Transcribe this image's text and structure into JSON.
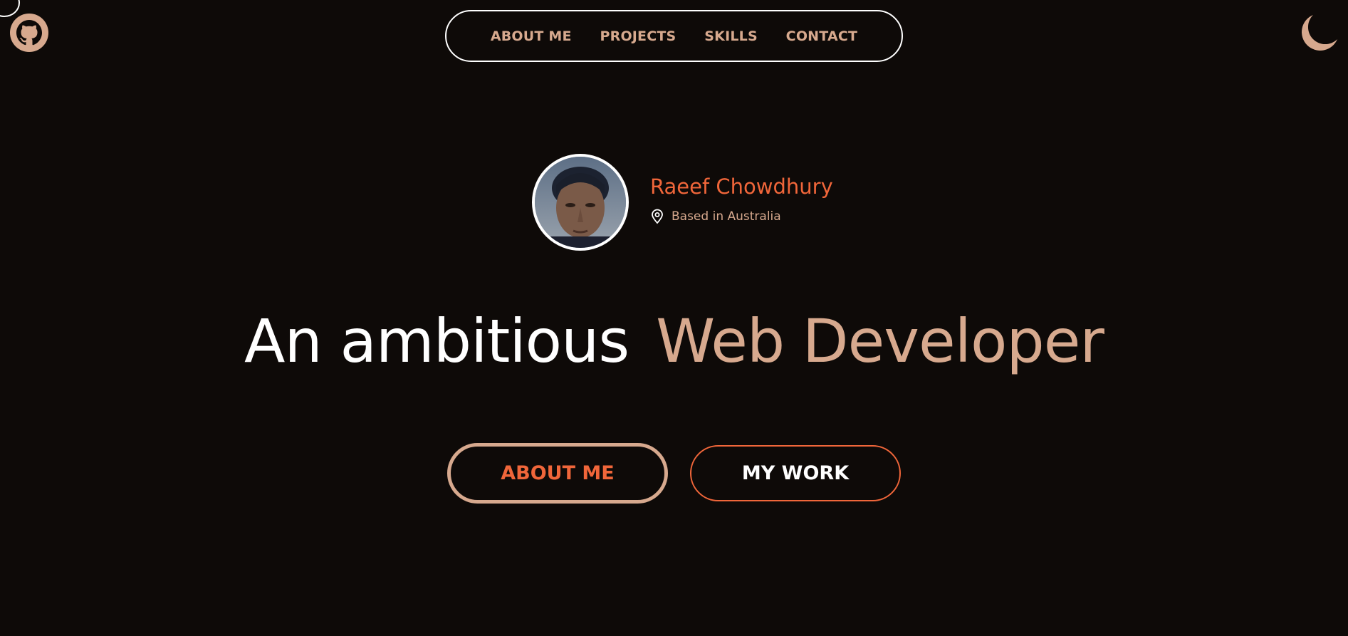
{
  "colors": {
    "background": "#0e0a08",
    "accent_orange": "#f0663a",
    "accent_tan": "#d7a98e",
    "white": "#ffffff"
  },
  "icons": {
    "github": "github-icon",
    "theme": "moon-icon",
    "location": "location-pin-icon"
  },
  "nav": {
    "items": [
      {
        "label": "ABOUT ME"
      },
      {
        "label": "PROJECTS"
      },
      {
        "label": "SKILLS"
      },
      {
        "label": "CONTACT"
      }
    ]
  },
  "profile": {
    "name": "Raeef Chowdhury",
    "location": "Based in Australia"
  },
  "hero": {
    "headline_plain": "An ambitious",
    "headline_accent": "Web Developer"
  },
  "cta": {
    "about_label": "ABOUT ME",
    "work_label": "MY WORK"
  }
}
